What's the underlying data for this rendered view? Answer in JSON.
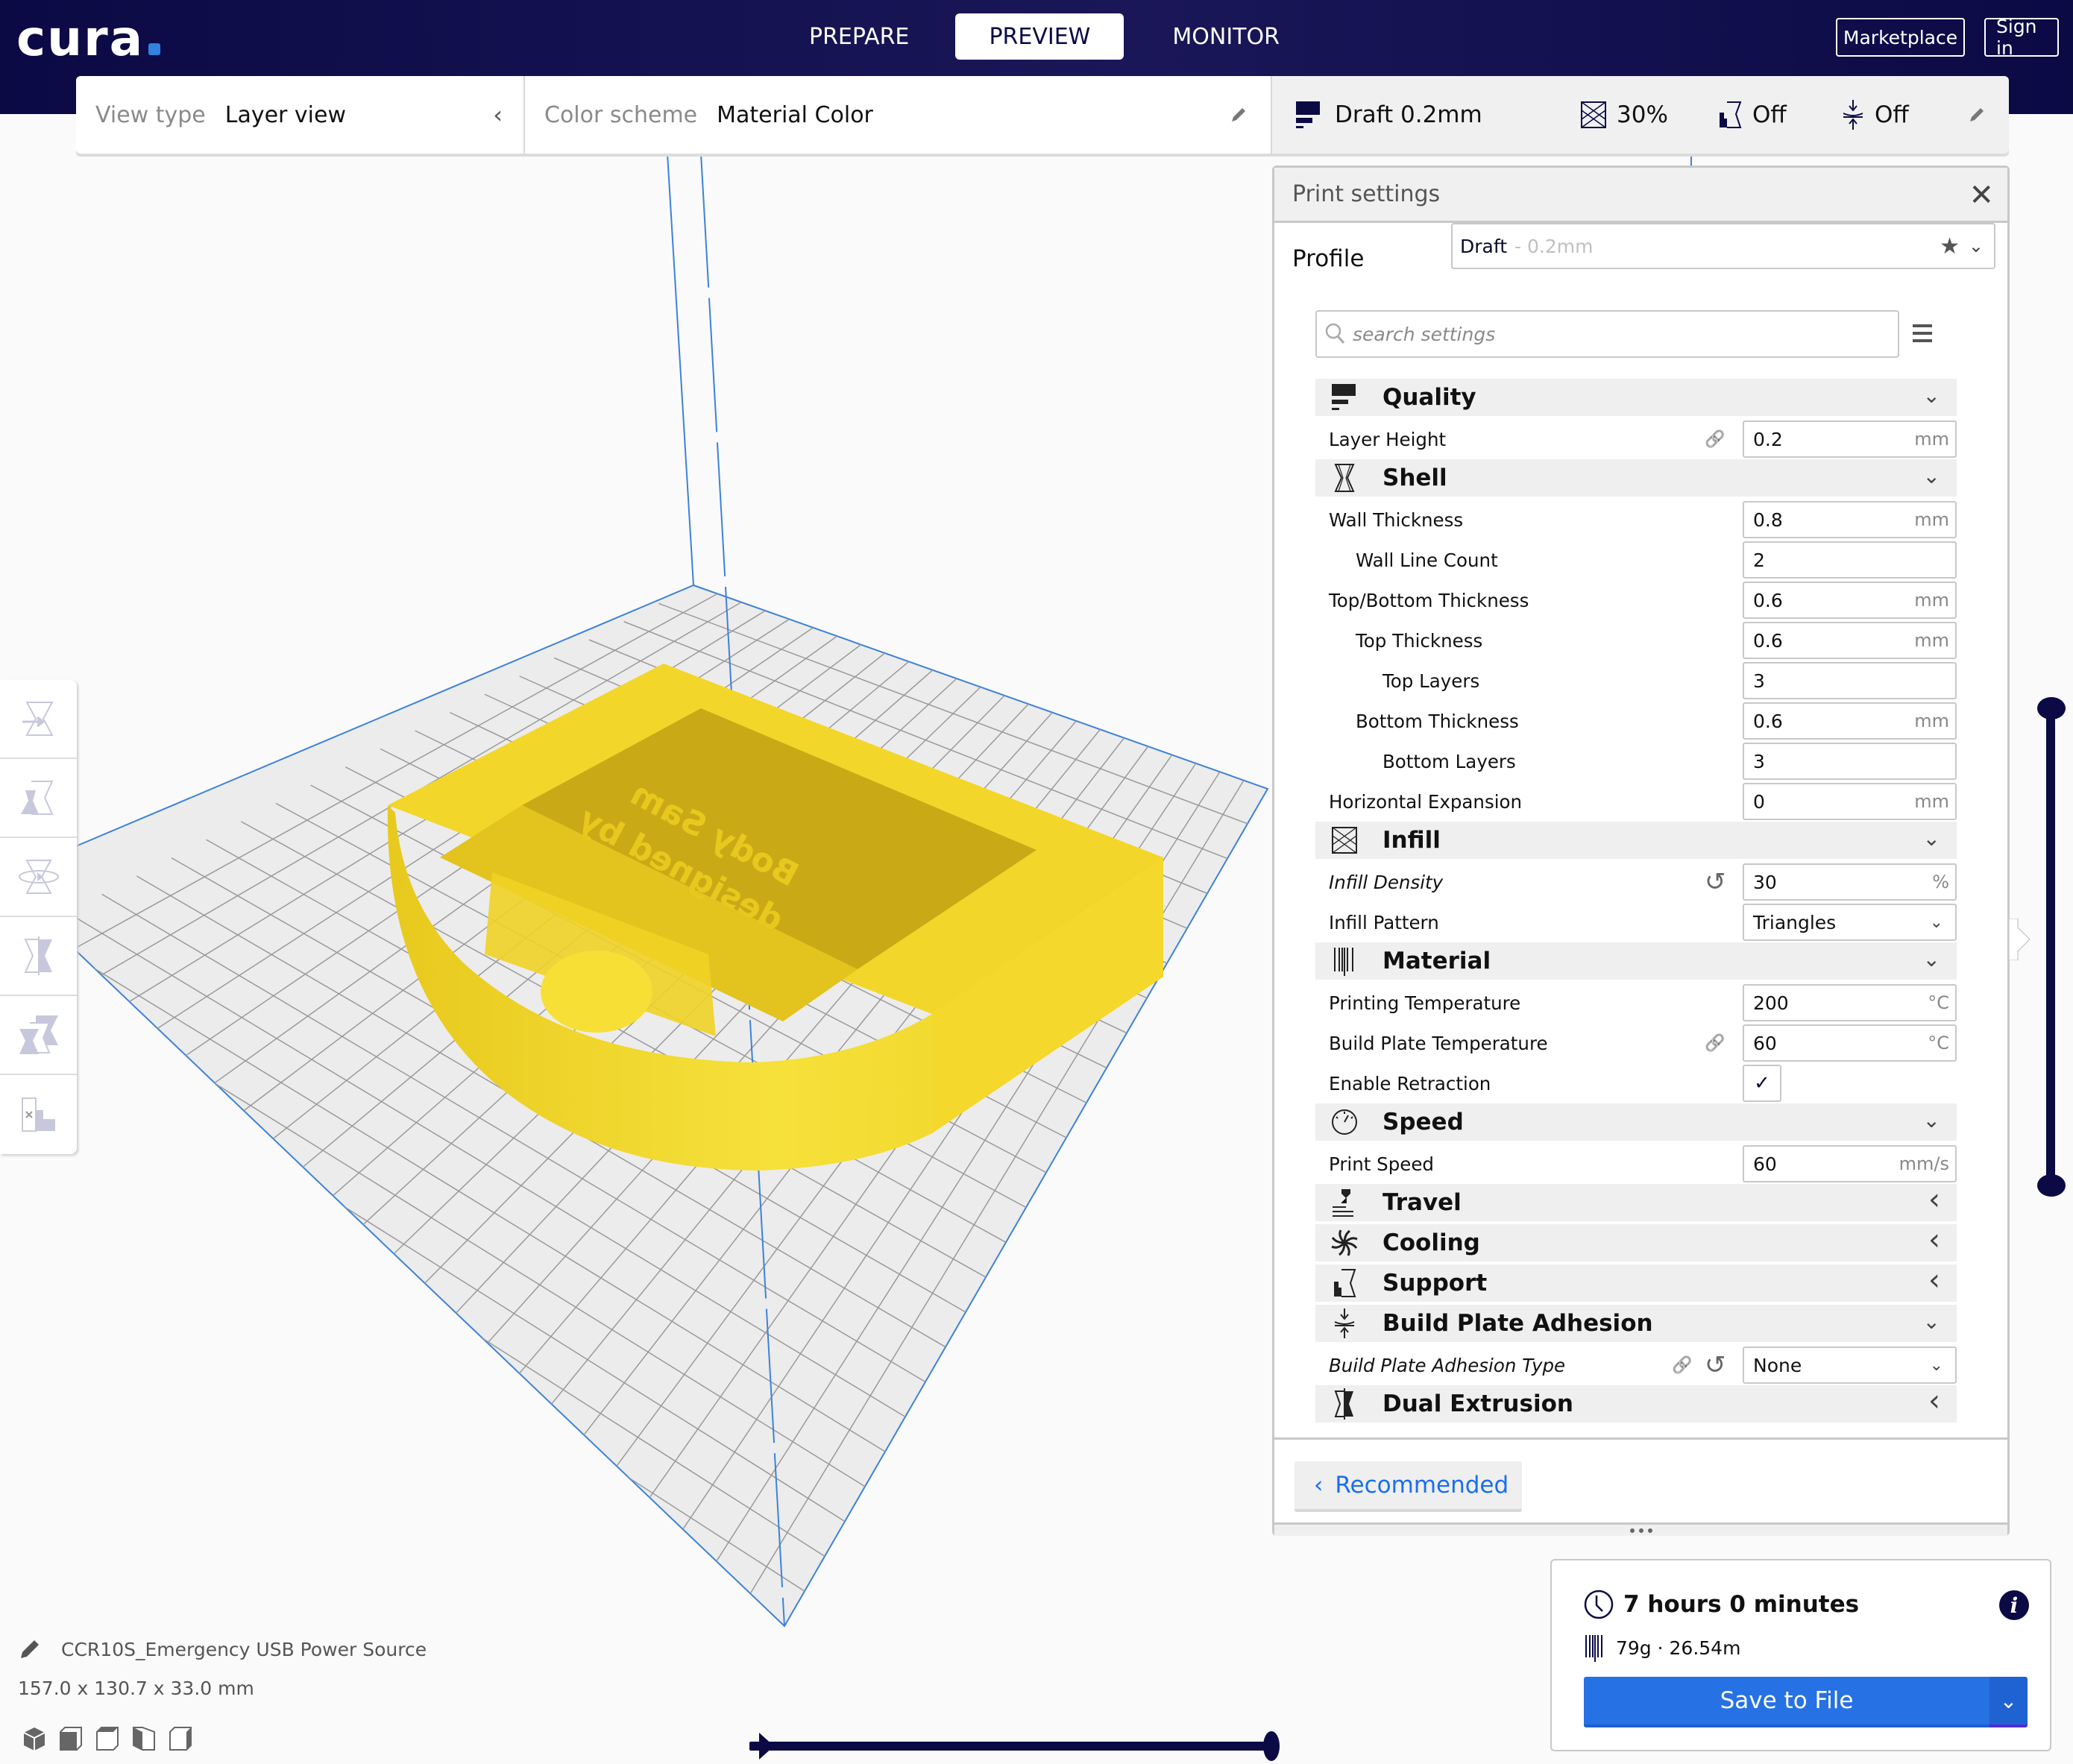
{
  "header": {
    "logo": "cura",
    "stages": [
      {
        "label": "PREPARE",
        "active": false
      },
      {
        "label": "PREVIEW",
        "active": true
      },
      {
        "label": "MONITOR",
        "active": false
      }
    ],
    "marketplace_label": "Marketplace",
    "signin_label": "Sign in"
  },
  "toolbar": {
    "view_type_label": "View type",
    "view_type_value": "Layer view",
    "color_scheme_label": "Color scheme",
    "color_scheme_value": "Material Color",
    "print_profile": "Draft 0.2mm",
    "infill": "30%",
    "support": "Off",
    "adhesion": "Off"
  },
  "print_settings": {
    "title": "Print settings",
    "profile_label": "Profile",
    "profile_name": "Draft",
    "profile_detail": "- 0.2mm",
    "search_placeholder": "search settings",
    "categories": [
      {
        "label": "Quality",
        "icon": "quality-icon",
        "expanded": true,
        "settings": [
          {
            "label": "Layer Height",
            "value": "0.2",
            "unit": "mm",
            "indent": 0,
            "linked": true
          }
        ]
      },
      {
        "label": "Shell",
        "icon": "shell-icon",
        "expanded": true,
        "settings": [
          {
            "label": "Wall Thickness",
            "value": "0.8",
            "unit": "mm",
            "indent": 0
          },
          {
            "label": "Wall Line Count",
            "value": "2",
            "unit": "",
            "indent": 1
          },
          {
            "label": "Top/Bottom Thickness",
            "value": "0.6",
            "unit": "mm",
            "indent": 0
          },
          {
            "label": "Top Thickness",
            "value": "0.6",
            "unit": "mm",
            "indent": 1
          },
          {
            "label": "Top Layers",
            "value": "3",
            "unit": "",
            "indent": 2
          },
          {
            "label": "Bottom Thickness",
            "value": "0.6",
            "unit": "mm",
            "indent": 1
          },
          {
            "label": "Bottom Layers",
            "value": "3",
            "unit": "",
            "indent": 2
          },
          {
            "label": "Horizontal Expansion",
            "value": "0",
            "unit": "mm",
            "indent": 0
          }
        ]
      },
      {
        "label": "Infill",
        "icon": "infill-icon",
        "expanded": true,
        "settings": [
          {
            "label": "Infill Density",
            "value": "30",
            "unit": "%",
            "indent": 0,
            "italic": true,
            "reset": true
          },
          {
            "label": "Infill Pattern",
            "value": "Triangles",
            "type": "dropdown",
            "indent": 0
          }
        ]
      },
      {
        "label": "Material",
        "icon": "material-icon",
        "expanded": true,
        "settings": [
          {
            "label": "Printing Temperature",
            "value": "200",
            "unit": "°C",
            "indent": 0
          },
          {
            "label": "Build Plate Temperature",
            "value": "60",
            "unit": "°C",
            "indent": 0,
            "linked": true
          },
          {
            "label": "Enable Retraction",
            "type": "checkbox",
            "checked": true,
            "indent": 0
          }
        ]
      },
      {
        "label": "Speed",
        "icon": "speed-icon",
        "expanded": true,
        "settings": [
          {
            "label": "Print Speed",
            "value": "60",
            "unit": "mm/s",
            "indent": 0
          }
        ]
      },
      {
        "label": "Travel",
        "icon": "travel-icon",
        "expanded": false,
        "settings": []
      },
      {
        "label": "Cooling",
        "icon": "cooling-icon",
        "expanded": false,
        "settings": []
      },
      {
        "label": "Support",
        "icon": "support-icon",
        "expanded": false,
        "settings": []
      },
      {
        "label": "Build Plate Adhesion",
        "icon": "adhesion-icon",
        "expanded": true,
        "settings": [
          {
            "label": "Build Plate Adhesion Type",
            "value": "None",
            "type": "dropdown",
            "indent": 0,
            "italic": true,
            "linked": true,
            "reset": true
          }
        ]
      },
      {
        "label": "Dual Extrusion",
        "icon": "dual-extrusion-icon",
        "expanded": false,
        "settings": []
      }
    ],
    "recommended_label": "Recommended"
  },
  "summary": {
    "time": "7 hours 0 minutes",
    "material": "79g · 26.54m",
    "save_label": "Save to File"
  },
  "object": {
    "name": "CCR10S_Emergency USB Power Source",
    "dimensions": "157.0 x 130.7 x 33.0 mm"
  },
  "layer_slider": {
    "upper_fraction": 1.0,
    "lower_fraction": 0.0
  },
  "simulation": {
    "progress_fraction": 1.0
  },
  "colors": {
    "header_bg": "#0b0a45",
    "accent_blue": "#2671e4",
    "material_yellow": "#f5dd2a",
    "plate_grid": "#8f8f8f",
    "plate_edge": "#3d82d8"
  }
}
